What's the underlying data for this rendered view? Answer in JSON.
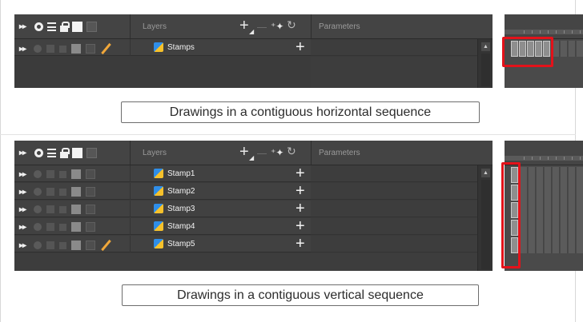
{
  "colors": {
    "panel_bg": "#3b3b3b",
    "highlight": "#e3121a",
    "layer_text": "#f2f2f2"
  },
  "header": {
    "layers_label": "Layers",
    "parameters_label": "Parameters",
    "icons": [
      "onion-skin-icon",
      "visibility-dot-icon",
      "stack-icon",
      "lock-icon",
      "color-swatch-icon",
      "swatch-dark-icon",
      "add-layer-icon",
      "add-peg-icon",
      "function-icon"
    ]
  },
  "panels": [
    {
      "id": "horizontal",
      "layers": [
        {
          "name": "Stamps",
          "has_pen": true
        }
      ],
      "caption": "Drawings in a contiguous horizontal sequence"
    },
    {
      "id": "vertical",
      "layers": [
        {
          "name": "Stamp1",
          "has_pen": false
        },
        {
          "name": "Stamp2",
          "has_pen": false
        },
        {
          "name": "Stamp3",
          "has_pen": false
        },
        {
          "name": "Stamp4",
          "has_pen": false
        },
        {
          "name": "Stamp5",
          "has_pen": true
        }
      ],
      "caption": "Drawings in a contiguous vertical sequence"
    }
  ]
}
